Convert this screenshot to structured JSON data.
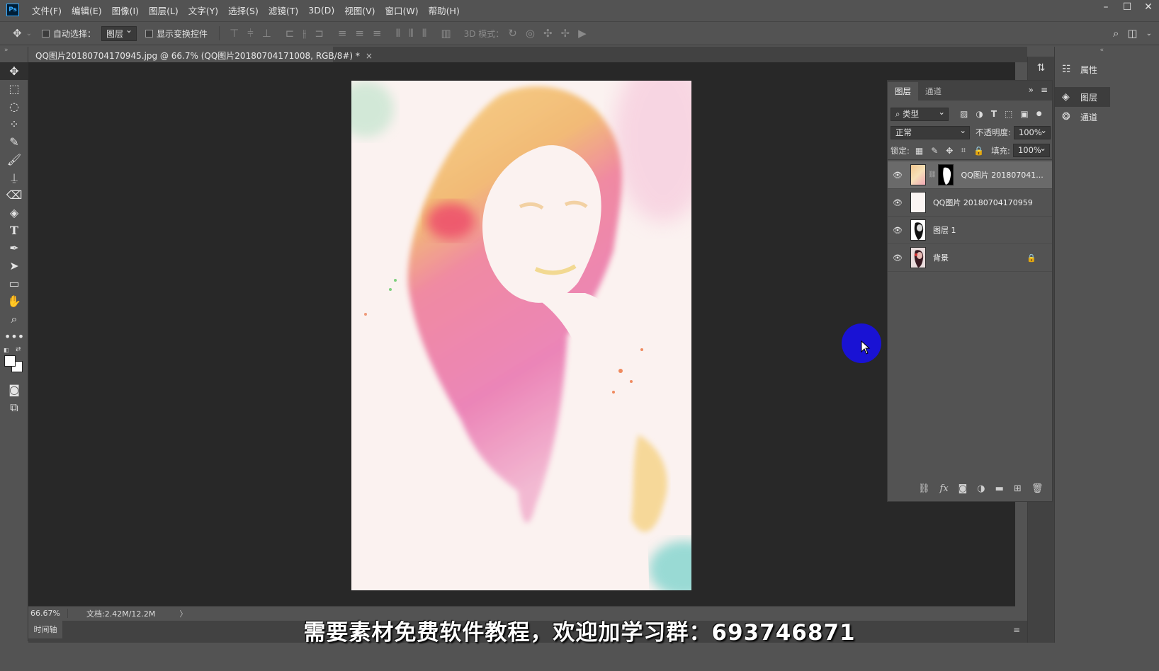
{
  "app": {
    "logo": "Ps"
  },
  "menu": [
    "文件(F)",
    "编辑(E)",
    "图像(I)",
    "图层(L)",
    "文字(Y)",
    "选择(S)",
    "滤镜(T)",
    "3D(D)",
    "视图(V)",
    "窗口(W)",
    "帮助(H)"
  ],
  "window_controls": {
    "minimize": "–",
    "maximize": "☐",
    "close": "✕"
  },
  "options": {
    "auto_select_label": "自动选择：",
    "auto_select_value": "图层",
    "show_transform_label": "显示变换控件",
    "mode_3d_label": "3D 模式："
  },
  "document": {
    "tab_title": "QQ图片20180704170945.jpg @ 66.7% (QQ图片20180704171008, RGB/8#) *",
    "tab_close": "×"
  },
  "status": {
    "zoom": "66.67%",
    "doc_info": "文档:2.42M/12.2M",
    "arrow": "〉"
  },
  "timeline": {
    "tab": "时间轴"
  },
  "caption": "需要素材免费软件教程，欢迎加学习群：693746871",
  "dock": {
    "properties": "属性",
    "layers": "图层",
    "channels": "通道"
  },
  "layers_panel": {
    "tabs": [
      "图层",
      "通道"
    ],
    "filter_type": "类型",
    "blend_mode": "正常",
    "opacity_label": "不透明度:",
    "opacity_value": "100%",
    "lock_label": "锁定:",
    "fill_label": "填充:",
    "fill_value": "100%",
    "layers": [
      {
        "name": "QQ图片 201807041...",
        "visible": true,
        "selected": true,
        "has_mask": true
      },
      {
        "name": "QQ图片 20180704170959",
        "visible": true,
        "selected": false
      },
      {
        "name": "图层 1",
        "visible": true,
        "selected": false
      },
      {
        "name": "背景",
        "visible": true,
        "selected": false,
        "locked": true
      }
    ]
  },
  "colors": {
    "accent_cursor": "#1912d4",
    "canvas_bg": "#282828",
    "ui_bg": "#535353"
  }
}
